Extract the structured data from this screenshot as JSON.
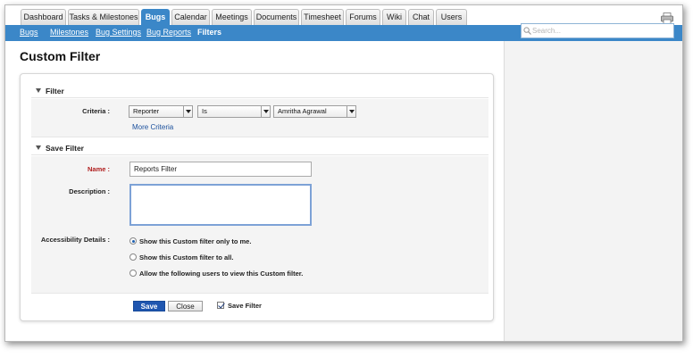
{
  "tabs": [
    {
      "label": "Dashboard"
    },
    {
      "label": "Tasks & Milestones"
    },
    {
      "label": "Bugs"
    },
    {
      "label": "Calendar"
    },
    {
      "label": "Meetings"
    },
    {
      "label": "Documents"
    },
    {
      "label": "Timesheet"
    },
    {
      "label": "Forums"
    },
    {
      "label": "Wiki"
    },
    {
      "label": "Chat"
    },
    {
      "label": "Users"
    }
  ],
  "active_tab": "Bugs",
  "subnav": [
    {
      "label": "Bugs"
    },
    {
      "label": "Milestones"
    },
    {
      "label": "Bug Settings"
    },
    {
      "label": "Bug Reports"
    },
    {
      "label": "Filters"
    }
  ],
  "active_subnav": "Filters",
  "search": {
    "placeholder": "Search..."
  },
  "page": {
    "title": "Custom Filter"
  },
  "filter_section": {
    "title": "Filter",
    "criteria_label": "Criteria :",
    "criteria_field": "Reporter",
    "criteria_operator": "Is",
    "criteria_value": "Amritha Agrawal",
    "more_criteria": "More Criteria"
  },
  "save_section": {
    "title": "Save Filter",
    "name_label": "Name :",
    "name_value": "Reports Filter",
    "description_label": "Description :",
    "description_value": "",
    "accessibility_label": "Accessibility Details :",
    "options": [
      {
        "label": "Show this Custom filter only to me."
      },
      {
        "label": "Show this Custom filter to all."
      },
      {
        "label": "Allow the following users to view this Custom filter."
      }
    ],
    "selected_option": 0
  },
  "footer": {
    "save_label": "Save",
    "close_label": "Close",
    "checkbox_label": "Save Filter",
    "checkbox_checked": true
  },
  "colors": {
    "accent": "#3b87c8",
    "button": "#1f56b0",
    "required": "#b01e1e",
    "link": "#1a4f9c"
  }
}
